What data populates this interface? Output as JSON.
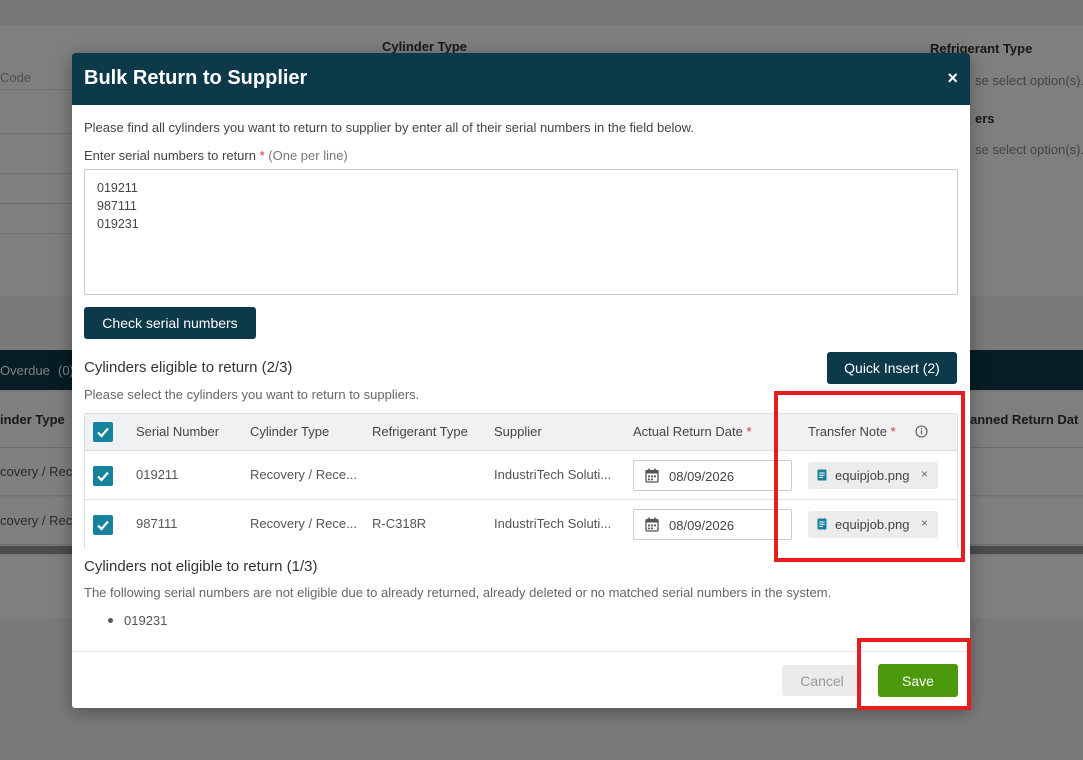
{
  "background": {
    "cylinder_type_label": "Cylinder Type",
    "refrigerant_type_label": "Refrigerant Type",
    "code_label": "Code",
    "select_placeholder_1": "se select option(s)...",
    "numbers_label": "ers",
    "select_placeholder_2": "se select option(s)...",
    "overdue_label": "Overdue",
    "overdue_count": "(0)",
    "cylinder_type_col": "inder Type",
    "planned_return_col": "anned Return Dat",
    "row1_text": "covery / Rec",
    "row2_text": "covery / Rec"
  },
  "modal": {
    "title": "Bulk Return to Supplier",
    "close_label": "×",
    "intro": "Please find all cylinders you want to return to supplier by enter all of their serial numbers in the field below.",
    "serial_label": "Enter serial numbers to return",
    "required_mark": "*",
    "serial_hint": "(One per line)",
    "serial_value": "019211\n987111\n019231",
    "check_button": "Check serial numbers",
    "eligible_title": "Cylinders eligible to return (2/3)",
    "eligible_sub": "Please select the cylinders you want to return to suppliers.",
    "quick_insert_button": "Quick Insert (2)",
    "table": {
      "headers": {
        "serial_number": "Serial Number",
        "cylinder_type": "Cylinder Type",
        "refrigerant_type": "Refrigerant Type",
        "supplier": "Supplier",
        "actual_return_date": "Actual Return Date",
        "transfer_note": "Transfer Note"
      },
      "rows": [
        {
          "serial": "019211",
          "cylinder_type": "Recovery / Rece...",
          "refrigerant": "",
          "supplier": "IndustriTech Soluti...",
          "date": "08/09/2026",
          "file": "equipjob.png",
          "remove": "×"
        },
        {
          "serial": "987111",
          "cylinder_type": "Recovery / Rece...",
          "refrigerant": "R-C318R",
          "supplier": "IndustriTech Soluti...",
          "date": "08/09/2026",
          "file": "equipjob.png",
          "remove": "×"
        }
      ]
    },
    "not_eligible_title": "Cylinders not eligible to return (1/3)",
    "not_eligible_sub": "The following serial numbers are not eligible due to already returned, already deleted or no matched serial numbers in the system.",
    "not_eligible_items": [
      "019231"
    ],
    "cancel_button": "Cancel",
    "save_button": "Save"
  },
  "colors": {
    "header_dark": "#0d3a4a",
    "checkbox_teal": "#17829b",
    "save_green": "#4c9a0b",
    "required_red": "#d62c2c",
    "annotation_red": "#e41e1e"
  }
}
